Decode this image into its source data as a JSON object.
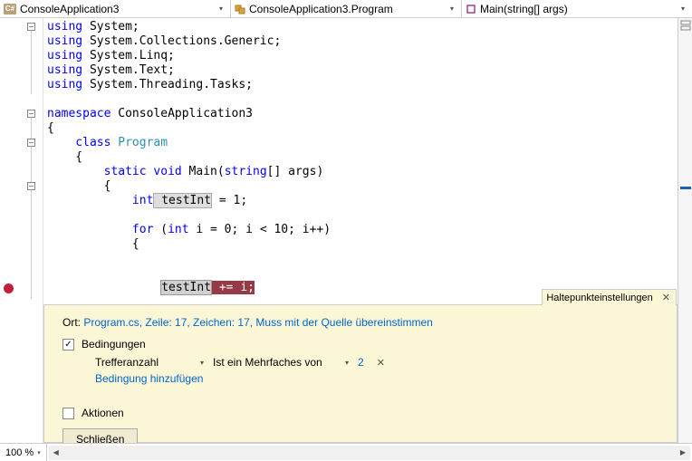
{
  "nav": {
    "project": "ConsoleApplication3",
    "class": "ConsoleApplication3.Program",
    "method": "Main(string[] args)"
  },
  "code": {
    "l1": {
      "kw": "using",
      "ns": " System;"
    },
    "l2": {
      "kw": "using",
      "ns": " System.Collections.Generic;"
    },
    "l3": {
      "kw": "using",
      "ns": " System.Linq;"
    },
    "l4": {
      "kw": "using",
      "ns": " System.Text;"
    },
    "l5": {
      "kw": "using",
      "ns": " System.Threading.Tasks;"
    },
    "l7": {
      "kw": "namespace",
      "nm": " ConsoleApplication3"
    },
    "l8": "{",
    "l9": {
      "kw": "    class",
      "nm": " Program"
    },
    "l10": "    {",
    "l11": {
      "pre": "        ",
      "kw1": "static",
      "kw2": " void",
      "nm": " Main(",
      "kw3": "string",
      "rest": "[] args)"
    },
    "l12": "        {",
    "l13": {
      "pre": "            ",
      "kw": "int",
      "hl": " testInt",
      "rest": " = 1;"
    },
    "l15": {
      "pre": "            ",
      "kw1": "for",
      "rest1": " (",
      "kw2": "int",
      "rest2": " i = 0; i < 10; i++)"
    },
    "l16": "            {",
    "l17": {
      "pre": "                ",
      "hl": "testInt",
      "rest": " += i;"
    }
  },
  "panel": {
    "tabTitle": "Haltepunkteinstellungen",
    "ortLabel": "Ort: ",
    "ortLink": "Program.cs, Zeile: 17, Zeichen: 17, Muss mit der Quelle übereinstimmen",
    "cond": {
      "checked": "✓",
      "label": "Bedingungen",
      "dd1": "Trefferanzahl",
      "dd2": "Ist ein Mehrfaches von",
      "value": "2",
      "addLink": "Bedingung hinzufügen"
    },
    "actions": {
      "label": "Aktionen"
    },
    "closeBtn": "Schließen"
  },
  "zoom": "100 %",
  "icons": {
    "csharp": "C#",
    "method": "◉"
  }
}
